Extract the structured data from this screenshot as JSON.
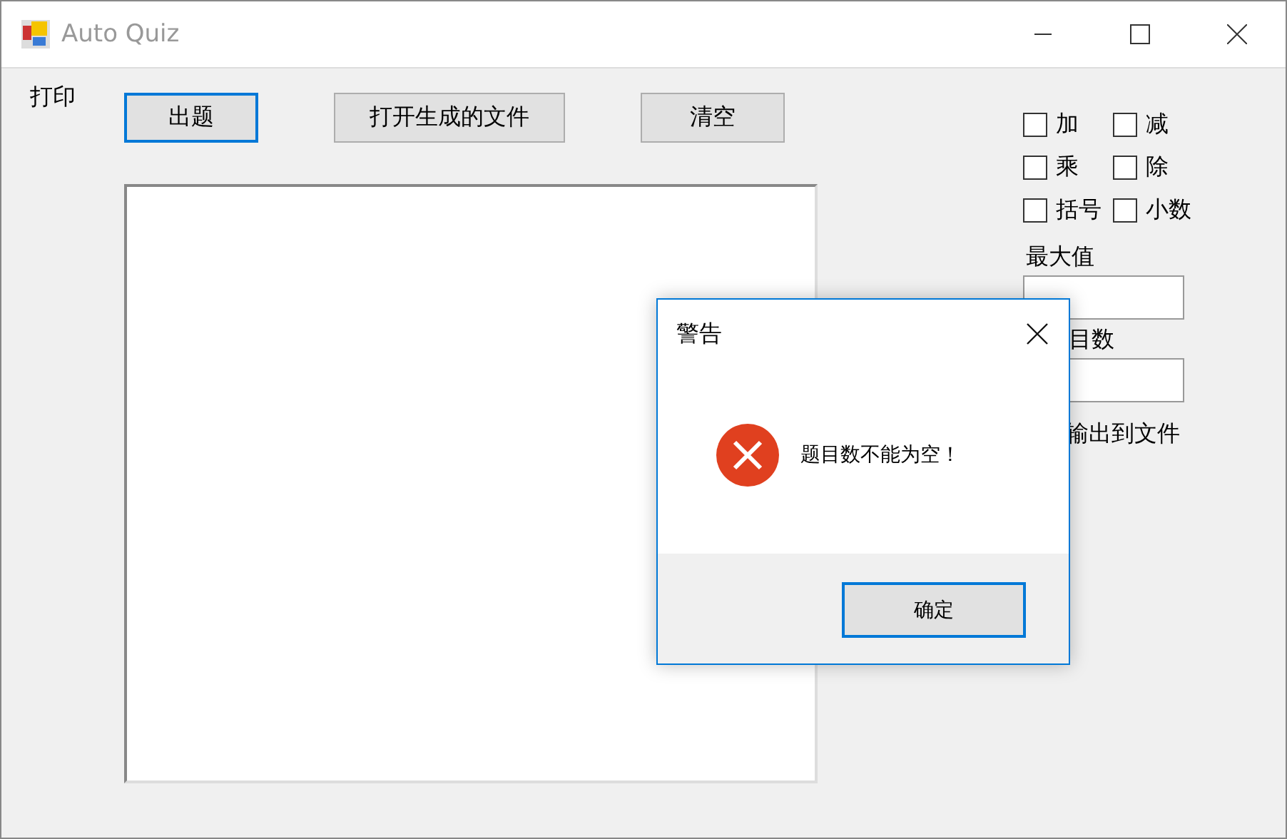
{
  "window": {
    "title": "Auto Quiz"
  },
  "menu": [
    {
      "label": "打印"
    }
  ],
  "buttons": [
    {
      "label": "出题",
      "focused": true
    },
    {
      "label": "打开生成的文件",
      "focused": false
    },
    {
      "label": "清空",
      "focused": false
    }
  ],
  "options": [
    {
      "label": "加",
      "checked": false
    },
    {
      "label": "减",
      "checked": false
    },
    {
      "label": "乘",
      "checked": false
    },
    {
      "label": "除",
      "checked": false
    },
    {
      "label": "括号",
      "checked": false
    },
    {
      "label": "小数",
      "checked": false
    }
  ],
  "fields": [
    {
      "label": "最大值"
    },
    {
      "label": "目数"
    }
  ],
  "output_label": "输出到文件",
  "dialog": {
    "title": "警告",
    "message": "题目数不能为空！",
    "button": "确定"
  }
}
